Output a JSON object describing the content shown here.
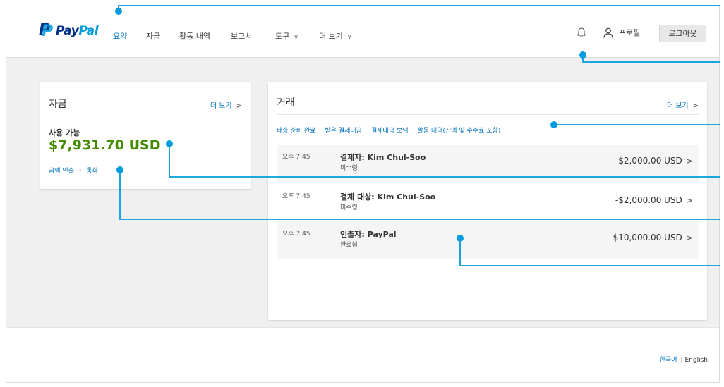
{
  "header": {
    "logo_pay": "Pay",
    "logo_pal": "Pal",
    "nav": [
      {
        "label": "요약",
        "active": true
      },
      {
        "label": "자금"
      },
      {
        "label": "활동 내역"
      },
      {
        "label": "보고서"
      },
      {
        "label": "도구",
        "dropdown": true
      },
      {
        "label": "더 보기",
        "dropdown": true
      }
    ],
    "profile_label": "프로필",
    "logout_label": "로그아웃"
  },
  "funds": {
    "title": "자금",
    "more_label": "더 보기",
    "available_label": "사용 가능",
    "available_amount": "$7,931.70 USD",
    "links": [
      "금액 인출",
      "통화"
    ]
  },
  "transactions": {
    "title": "거래",
    "more_label": "더 보기",
    "filters": [
      "배송 준비 완료",
      "받은 결제대금",
      "결제대금 보냄",
      "활동 내역(잔액 및 수수료 포함)"
    ],
    "items": [
      {
        "time": "오후 7:45",
        "name": "결제자: Kim Chul-Soo",
        "status": "미수령",
        "amount": "$2,000.00 USD"
      },
      {
        "time": "오후 7:45",
        "name": "결제 대상: Kim Chul-Soo",
        "status": "미수령",
        "amount": "-$2,000.00 USD"
      },
      {
        "time": "오후 7:45",
        "name": "인출자: PayPal",
        "status": "완료됨",
        "amount": "$10,000.00 USD"
      }
    ]
  },
  "footer": {
    "lang_korean": "한국어",
    "lang_english": "English"
  },
  "colors": {
    "brand_dark": "#003087",
    "brand_light": "#009cde",
    "link": "#0070ba",
    "balance_green": "#458b00",
    "callout": "#009cde"
  }
}
